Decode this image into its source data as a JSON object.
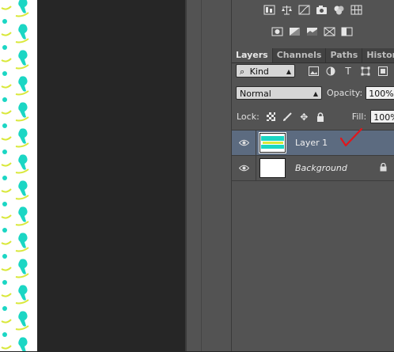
{
  "toolbar_icons_row1": [
    "levels-icon",
    "balance-icon",
    "curves-icon",
    "camera-icon",
    "color-balance-icon",
    "grid-icon"
  ],
  "toolbar_icons_row2": [
    "photo-filter-icon",
    "gradient-map-icon",
    "posterize-icon",
    "threshold-icon",
    "invert-icon"
  ],
  "tabs": [
    {
      "label": "Layers",
      "active": true
    },
    {
      "label": "Channels",
      "active": false
    },
    {
      "label": "Paths",
      "active": false
    },
    {
      "label": "History",
      "active": false
    }
  ],
  "filter": {
    "kind_label": "Kind",
    "kind_prefix": "⌕"
  },
  "blend": {
    "mode": "Normal",
    "opacity_label": "Opacity:",
    "opacity_value": "100%"
  },
  "lock": {
    "label": "Lock:",
    "fill_label": "Fill:",
    "fill_value": "100%"
  },
  "layers": [
    {
      "name": "Layer 1",
      "selected": true,
      "visible": true
    },
    {
      "name": "Background",
      "selected": false,
      "visible": true,
      "locked": true
    }
  ],
  "colors": {
    "accent": "#5c6b80",
    "check": "#e0161b",
    "pattern_cyan": "#1bd6c4",
    "pattern_yellow": "#d9e83a"
  }
}
